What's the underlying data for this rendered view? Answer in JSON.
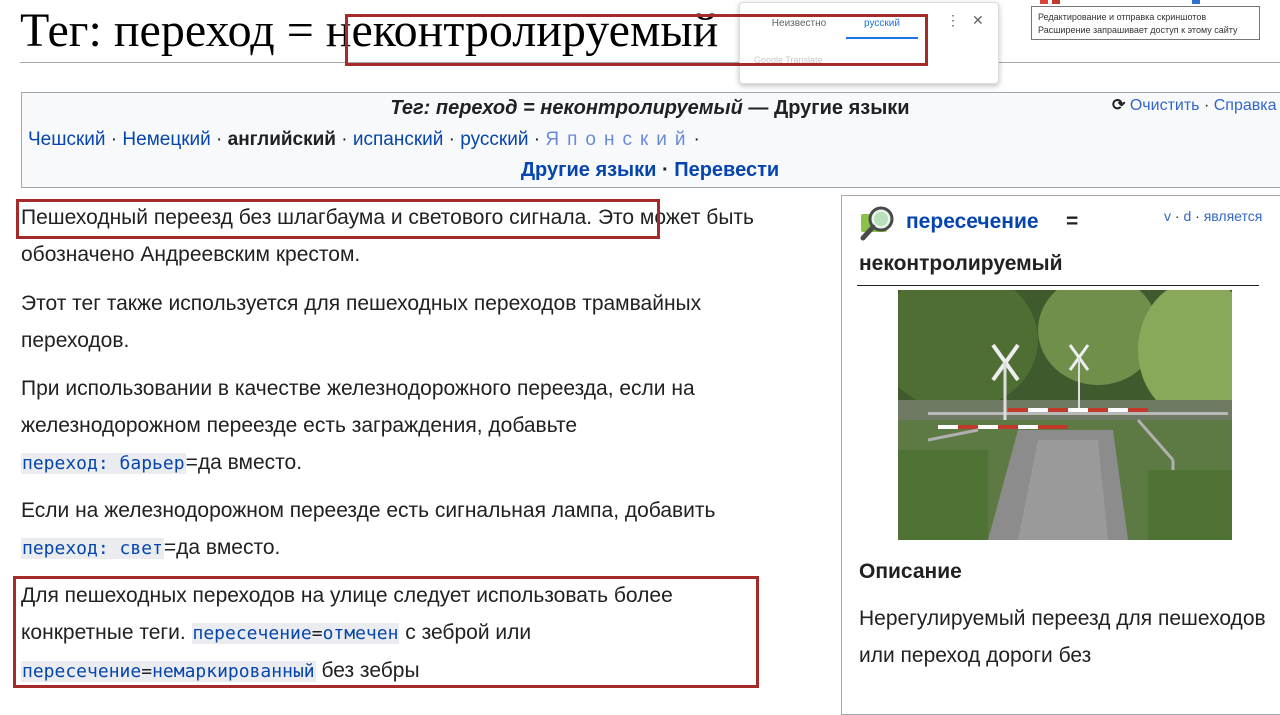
{
  "title": {
    "prefix": "Тег: переход = ",
    "value": "неконтролируемый"
  },
  "translate_popup": {
    "tab_unknown": "Неизвестно",
    "tab_russian": "русский",
    "more_icon": "⋮",
    "close_icon": "✕",
    "footer": "Google Translate"
  },
  "extension_tooltip": {
    "line1": "Редактирование и отправка скриншотов",
    "line2": "Расширение запрашивает доступ к этому сайту"
  },
  "languages_box": {
    "title_italic": "Тег: переход = неконтролируемый",
    "title_rest": " — Другие языки",
    "purge_label": "Очистить",
    "help_label": "Справка",
    "languages": [
      {
        "label": "Чешский",
        "current": false
      },
      {
        "label": "Немецкий",
        "current": false
      },
      {
        "label": "английский",
        "current": true
      },
      {
        "label": "испанский",
        "current": false
      },
      {
        "label": "русский",
        "current": false
      },
      {
        "label": "Японский",
        "current": false
      }
    ],
    "other_languages": "Другие языки",
    "translate": "Перевести"
  },
  "content": {
    "p1_highlight": "Пешеходный переезд без шлагбаума и светового сигнала.",
    "p1_rest": " Это может быть обозначено Андреевским крестом.",
    "p2": "Этот тег также используется для пешеходных переходов трамвайных переходов.",
    "p3_text": "При использовании в качестве железнодорожного переезда, если на железнодорожном переезде есть заграждения, добавьте",
    "p3_code": "переход: барьер",
    "p3_eq": "=",
    "p3_val": "да",
    "p3_after": " вместо.",
    "p4_text": "Если на железнодорожном переезде есть сигнальная лампа, добавить",
    "p4_code": "переход: свет",
    "p4_eq": "=",
    "p4_val": "да",
    "p4_after": " вместо.",
    "p5_text": "Для пешеходных переходов на улице следует использовать более конкретные теги. ",
    "p5_code1_key": "пересечение",
    "p5_code1_val": "отмечен",
    "p5_mid": " с зеброй или",
    "p5_code2_key": "пересечение",
    "p5_code2_val": "немаркированный",
    "p5_end": " без зебры"
  },
  "infobox": {
    "key": "пересечение",
    "eq": "=",
    "value": "неконтролируемый",
    "link_v": "v",
    "link_d": "d",
    "link_is": "является",
    "description_title": "Описание",
    "description_text": "Нерегулируемый переезд для пешеходов или переход дороги без"
  },
  "colors": {
    "link": "#0645ad",
    "highlight_border": "#a52a2a",
    "box_bg": "#f8f9fa"
  }
}
